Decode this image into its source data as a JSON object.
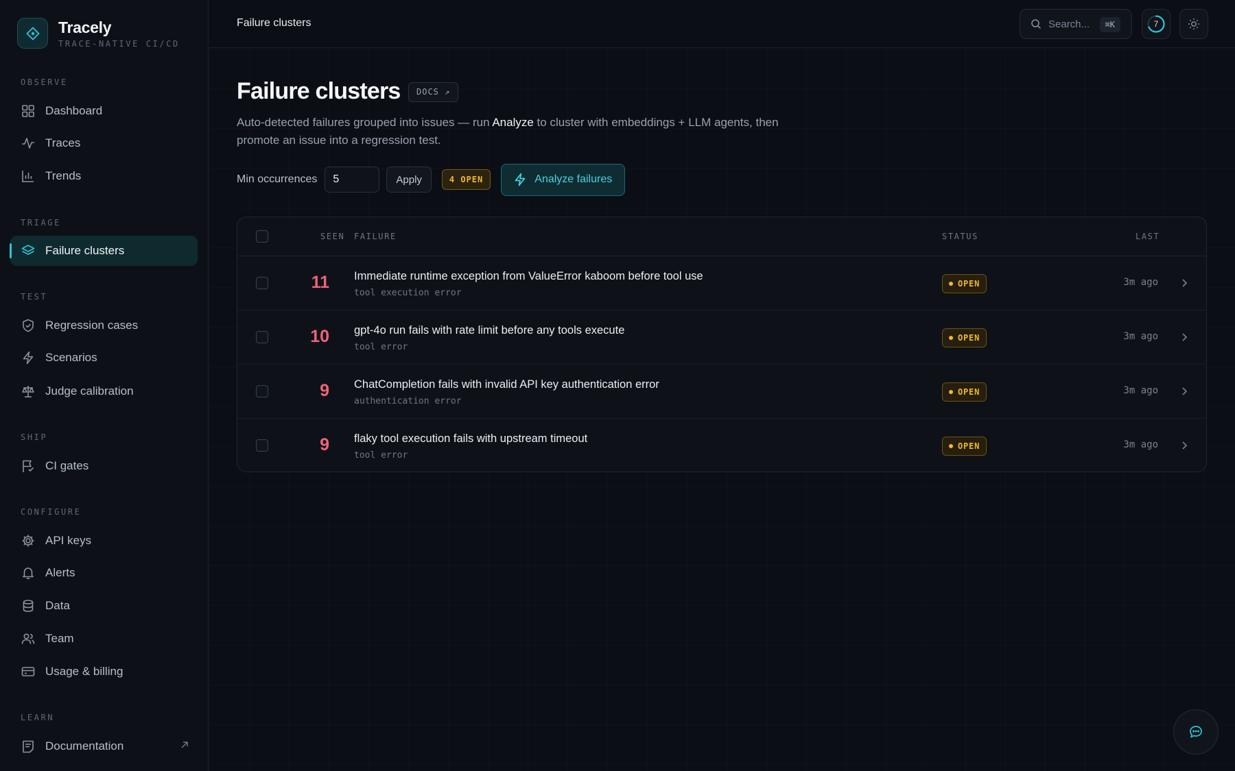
{
  "brand": {
    "name": "Tracely",
    "tagline": "TRACE-NATIVE CI/CD"
  },
  "sidebar": {
    "sections": {
      "observe": "OBSERVE",
      "triage": "TRIAGE",
      "test": "TEST",
      "ship": "SHIP",
      "configure": "CONFIGURE",
      "learn": "LEARN"
    },
    "items": {
      "dashboard": "Dashboard",
      "traces": "Traces",
      "trends": "Trends",
      "failure_clusters": "Failure clusters",
      "regression_cases": "Regression cases",
      "scenarios": "Scenarios",
      "judge_calibration": "Judge calibration",
      "ci_gates": "CI gates",
      "api_keys": "API keys",
      "alerts": "Alerts",
      "data": "Data",
      "team": "Team",
      "usage_billing": "Usage & billing",
      "documentation": "Documentation"
    },
    "active": "failure_clusters"
  },
  "topbar": {
    "breadcrumb": "Failure clusters",
    "search_placeholder": "Search...",
    "search_shortcut": "⌘K",
    "counter": "7"
  },
  "page": {
    "title": "Failure clusters",
    "docs_label": "DOCS ↗",
    "subtitle_before": "Auto-detected failures grouped into issues — run ",
    "subtitle_highlight": "Analyze",
    "subtitle_after": " to cluster with embeddings + LLM agents, then promote an issue into a regression test.",
    "filter_label": "Min occurrences",
    "min_occurrences": "5",
    "apply_label": "Apply",
    "open_count_badge": "4 OPEN",
    "analyze_label": "Analyze failures"
  },
  "table": {
    "headers": {
      "seen": "SEEN",
      "failure": "FAILURE",
      "status": "STATUS",
      "last": "LAST"
    },
    "rows": [
      {
        "seen": "11",
        "title": "Immediate runtime exception from ValueError kaboom before tool use",
        "category": "tool execution error",
        "status": "OPEN",
        "last": "3m ago"
      },
      {
        "seen": "10",
        "title": "gpt-4o run fails with rate limit before any tools execute",
        "category": "tool error",
        "status": "OPEN",
        "last": "3m ago"
      },
      {
        "seen": "9",
        "title": "ChatCompletion fails with invalid API key authentication error",
        "category": "authentication error",
        "status": "OPEN",
        "last": "3m ago"
      },
      {
        "seen": "9",
        "title": "flaky tool execution fails with upstream timeout",
        "category": "tool error",
        "status": "OPEN",
        "last": "3m ago"
      }
    ]
  },
  "colors": {
    "accent": "#2cc6d6",
    "seen_count": "#f0627a",
    "open_status": "#f2b731",
    "background": "#0b0e14"
  },
  "icons": {
    "brand": "diamond-logo-icon",
    "dashboard": "grid-icon",
    "traces": "pulse-icon",
    "trends": "bar-chart-icon",
    "failure_clusters": "layers-icon",
    "regression_cases": "shield-check-icon",
    "scenarios": "lightning-icon",
    "judge_calibration": "scale-icon",
    "ci_gates": "flag-check-icon",
    "api_keys": "gear-icon",
    "alerts": "bell-icon",
    "data": "database-icon",
    "team": "users-icon",
    "usage_billing": "credit-card-icon",
    "documentation": "doc-icon",
    "chat": "chat-icon"
  }
}
